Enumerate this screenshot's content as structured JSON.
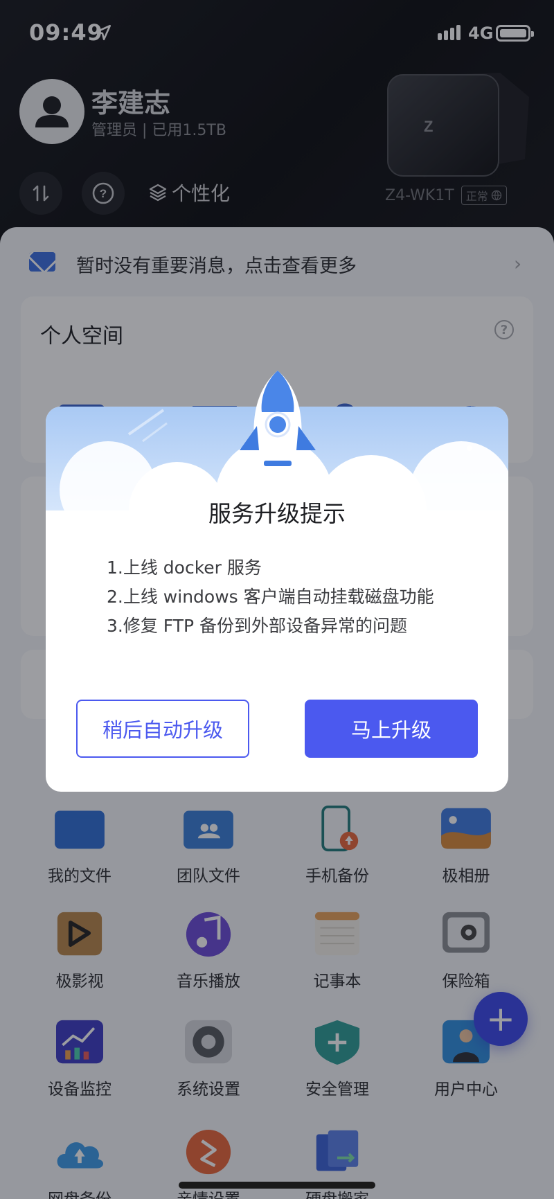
{
  "status_bar": {
    "time": "09:49",
    "network": "4G"
  },
  "header": {
    "user_name": "李建志",
    "user_meta": "管理员 | 已用1.5TB",
    "personalize_label": "个性化",
    "device_name": "Z4-WK1T",
    "device_status": "正常"
  },
  "message_bar": {
    "text": "暂时没有重要消息，点击查看更多"
  },
  "personal_space": {
    "title": "个人空间"
  },
  "apps": [
    {
      "label": "我的文件",
      "icon": "my-files-icon",
      "color": "#2f6fd6"
    },
    {
      "label": "团队文件",
      "icon": "team-files-icon",
      "color": "#3a7fd8"
    },
    {
      "label": "手机备份",
      "icon": "phone-backup-icon",
      "color": "#1f7a7a"
    },
    {
      "label": "极相册",
      "icon": "photo-album-icon",
      "color": "#d98b3a"
    },
    {
      "label": "极影视",
      "icon": "video-icon",
      "color": "#b8874a"
    },
    {
      "label": "音乐播放",
      "icon": "music-icon",
      "color": "#6b4bd8"
    },
    {
      "label": "记事本",
      "icon": "notepad-icon",
      "color": "#e8a25a"
    },
    {
      "label": "保险箱",
      "icon": "safe-icon",
      "color": "#8a8d93"
    },
    {
      "label": "设备监控",
      "icon": "monitor-icon",
      "color": "#3d3cc4"
    },
    {
      "label": "系统设置",
      "icon": "settings-icon",
      "color": "#55585e"
    },
    {
      "label": "安全管理",
      "icon": "security-icon",
      "color": "#2e9e96"
    },
    {
      "label": "用户中心",
      "icon": "user-center-icon",
      "color": "#2f8fe0"
    },
    {
      "label": "网盘备份",
      "icon": "cloud-backup-icon",
      "color": "#3d9be8"
    },
    {
      "label": "亲情设置",
      "icon": "family-icon",
      "color": "#e8663a"
    },
    {
      "label": "硬盘搬家",
      "icon": "disk-move-icon",
      "color": "#3b62d8"
    }
  ],
  "dialog": {
    "title": "服务升级提示",
    "lines": [
      "1.上线 docker 服务",
      "2.上线 windows 客户端自动挂载磁盘功能",
      "3.修复 FTP 备份到外部设备异常的问题"
    ],
    "later_button": "稍后自动升级",
    "now_button": "马上升级"
  },
  "fab_label": "+"
}
